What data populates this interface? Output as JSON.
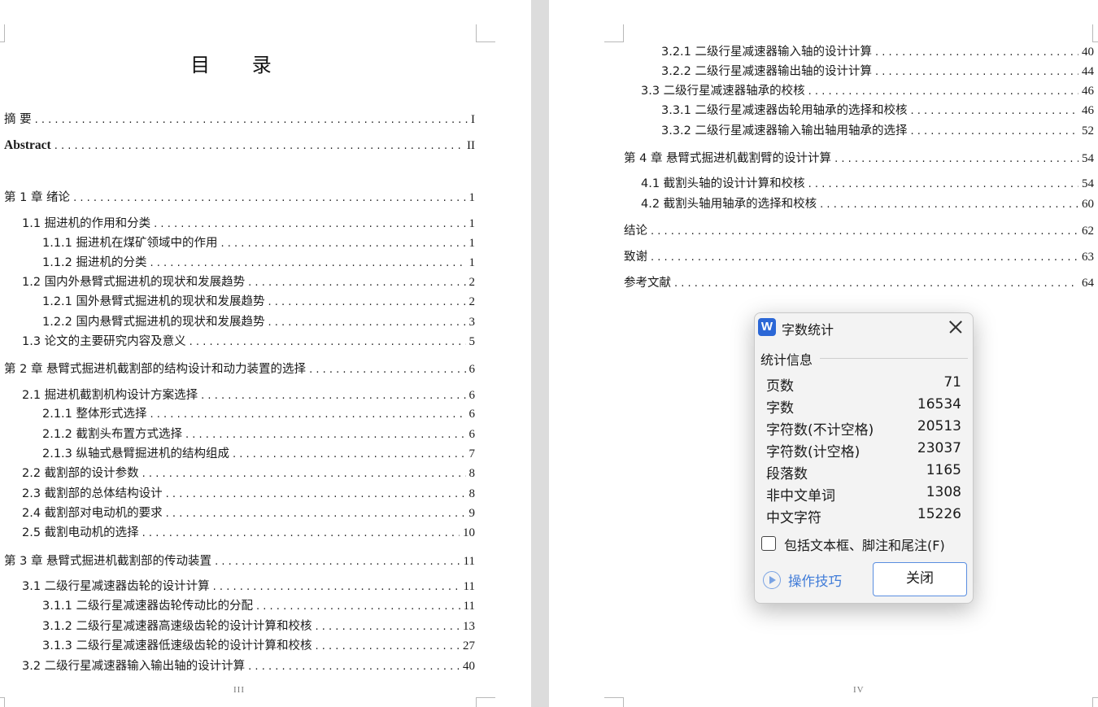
{
  "left_page": {
    "title": "目 录",
    "page_number": "III",
    "entries": [
      {
        "label": "摘 要",
        "page": "I"
      },
      {
        "label": "Abstract",
        "page": "II"
      },
      {
        "label": "第 1 章 绪论",
        "page": "1"
      },
      {
        "label": "1.1 掘进机的作用和分类",
        "page": "1"
      },
      {
        "label": "1.1.1 掘进机在煤矿领域中的作用",
        "page": "1"
      },
      {
        "label": "1.1.2 掘进机的分类",
        "page": "1"
      },
      {
        "label": "1.2 国内外悬臂式掘进机的现状和发展趋势",
        "page": "2"
      },
      {
        "label": "1.2.1 国外悬臂式掘进机的现状和发展趋势",
        "page": "2"
      },
      {
        "label": "1.2.2 国内悬臂式掘进机的现状和发展趋势",
        "page": "3"
      },
      {
        "label": "1.3 论文的主要研究内容及意义",
        "page": "5"
      },
      {
        "label": "第 2 章 悬臂式掘进机截割部的结构设计和动力装置的选择",
        "page": "6"
      },
      {
        "label": "2.1 掘进机截割机构设计方案选择",
        "page": "6"
      },
      {
        "label": "2.1.1 整体形式选择",
        "page": "6"
      },
      {
        "label": "2.1.2 截割头布置方式选择",
        "page": "6"
      },
      {
        "label": "2.1.3 纵轴式悬臂掘进机的结构组成",
        "page": "7"
      },
      {
        "label": "2.2 截割部的设计参数",
        "page": "8"
      },
      {
        "label": "2.3 截割部的总体结构设计",
        "page": "8"
      },
      {
        "label": "2.4 截割部对电动机的要求",
        "page": "9"
      },
      {
        "label": "2.5 截割电动机的选择",
        "page": "10"
      },
      {
        "label": "第 3 章 悬臂式掘进机截割部的传动装置",
        "page": "11"
      },
      {
        "label": "3.1 二级行星减速器齿轮的设计计算",
        "page": "11"
      },
      {
        "label": "3.1.1 二级行星减速器齿轮传动比的分配",
        "page": "11"
      },
      {
        "label": "3.1.2 二级行星减速器高速级齿轮的设计计算和校核",
        "page": "13"
      },
      {
        "label": "3.1.3 二级行星减速器低速级齿轮的设计计算和校核",
        "page": "27"
      },
      {
        "label": "3.2 二级行星减速器输入输出轴的设计计算",
        "page": "40"
      }
    ]
  },
  "right_page": {
    "page_number": "IV",
    "entries": [
      {
        "label": "3.2.1 二级行星减速器输入轴的设计计算",
        "page": "40"
      },
      {
        "label": "3.2.2 二级行星减速器输出轴的设计计算",
        "page": "44"
      },
      {
        "label": "3.3 二级行星减速器轴承的校核",
        "page": "46"
      },
      {
        "label": "3.3.1 二级行星减速器齿轮用轴承的选择和校核",
        "page": "46"
      },
      {
        "label": "3.3.2 二级行星减速器输入输出轴用轴承的选择",
        "page": "52"
      },
      {
        "label": "第 4 章 悬臂式掘进机截割臂的设计计算",
        "page": "54"
      },
      {
        "label": "4.1 截割头轴的设计计算和校核",
        "page": "54"
      },
      {
        "label": "4.2 截割头轴用轴承的选择和校核",
        "page": "60"
      },
      {
        "label": "结论",
        "page": "62"
      },
      {
        "label": "致谢",
        "page": "63"
      },
      {
        "label": "参考文献",
        "page": "64"
      }
    ]
  },
  "dialog": {
    "app_icon": "W",
    "title": "字数统计",
    "section_label": "统计信息",
    "stats": [
      {
        "key": "页数",
        "value": "71"
      },
      {
        "key": "字数",
        "value": "16534"
      },
      {
        "key": "字符数(不计空格)",
        "value": "20513"
      },
      {
        "key": "字符数(计空格)",
        "value": "23037"
      },
      {
        "key": "段落数",
        "value": "1165"
      },
      {
        "key": "非中文单词",
        "value": "1308"
      },
      {
        "key": "中文字符",
        "value": "15226"
      }
    ],
    "checkbox_label": "包括文本框、脚注和尾注(F)",
    "checkbox_checked": false,
    "tips_label": "操作技巧",
    "close_button": "关闭"
  }
}
